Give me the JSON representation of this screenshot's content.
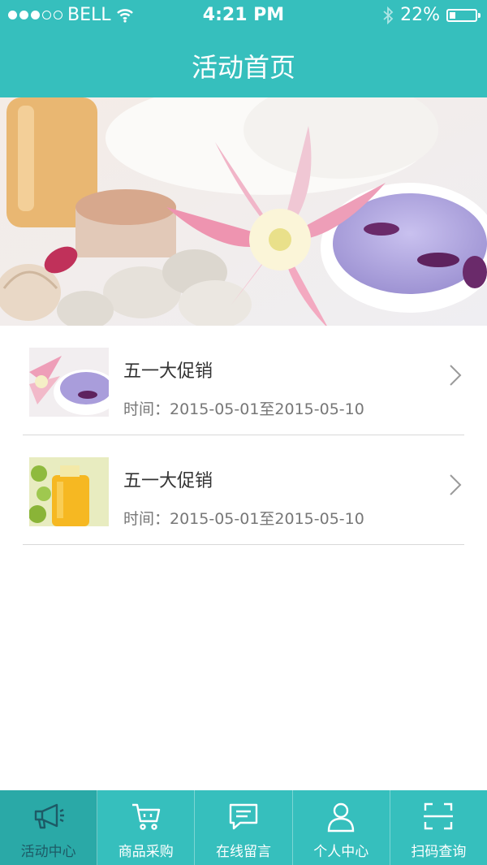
{
  "status": {
    "carrier": "BELL",
    "time": "4:21 PM",
    "battery": "22%"
  },
  "header": {
    "title": "活动首页"
  },
  "promotions": [
    {
      "title": "五一大促销",
      "time": "时间：2015-05-01至2015-05-10",
      "thumb": "spa-bath-salt-image"
    },
    {
      "title": "五一大促销",
      "time": "时间：2015-05-01至2015-05-10",
      "thumb": "essential-oil-image"
    }
  ],
  "tabs": [
    {
      "label": "活动中心",
      "icon": "megaphone-icon",
      "active": true
    },
    {
      "label": "商品采购",
      "icon": "cart-icon",
      "active": false
    },
    {
      "label": "在线留言",
      "icon": "message-icon",
      "active": false
    },
    {
      "label": "个人中心",
      "icon": "user-icon",
      "active": false
    },
    {
      "label": "扫码查询",
      "icon": "scan-icon",
      "active": false
    }
  ],
  "colors": {
    "brand": "#36bfbd",
    "active_tab": "#2aa9a7"
  }
}
